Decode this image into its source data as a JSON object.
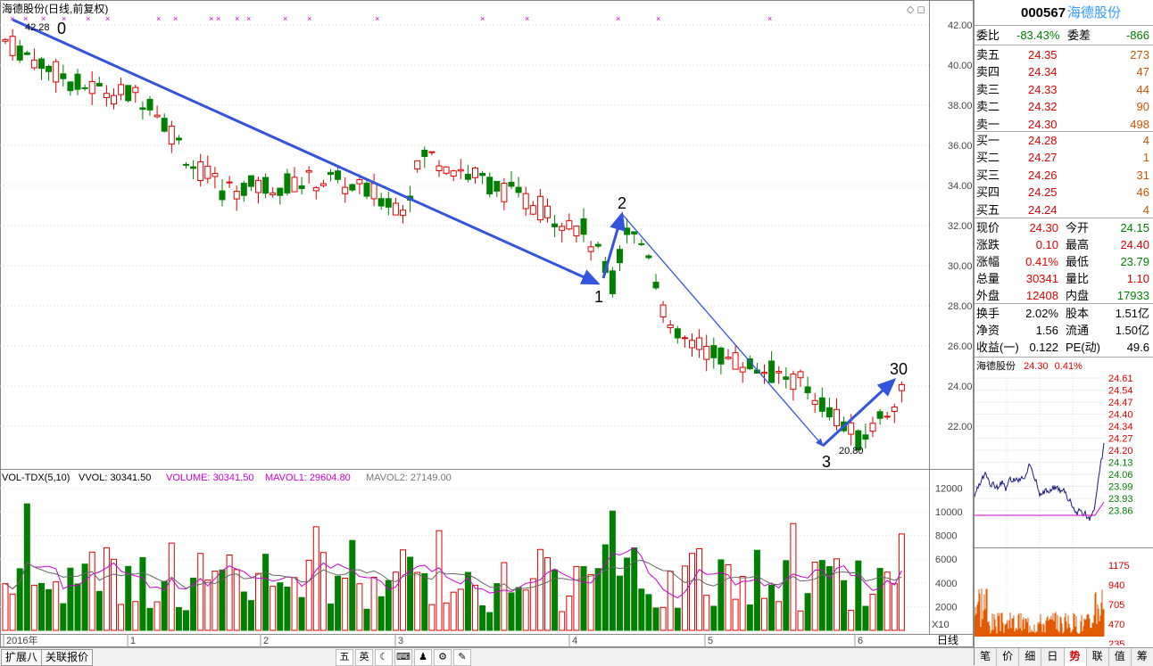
{
  "chart_header": {
    "title": "海德股份(日线,前复权)"
  },
  "price_axis": [
    "42.00",
    "40.00",
    "38.00",
    "36.00",
    "34.00",
    "32.00",
    "30.00",
    "28.00",
    "26.00",
    "24.00",
    "22.00"
  ],
  "annotations": {
    "high_label": "42.28",
    "low_label": "20.80",
    "wave_labels": [
      "0",
      "1",
      "2",
      "3",
      "30"
    ]
  },
  "volume_header": {
    "indicator": "VOL-TDX(5,10)",
    "vvol": "VVOL: 30341.50",
    "volume": "VOLUME: 30341.50",
    "mavol1": "MAVOL1: 29604.80",
    "mavol2": "MAVOL2: 27149.00"
  },
  "volume_axis": [
    "12000",
    "10000",
    "8000",
    "6000",
    "4000",
    "2000"
  ],
  "volume_unit": "X10",
  "date_axis": [
    "2016年",
    "1",
    "2",
    "3",
    "4",
    "5",
    "6"
  ],
  "period_label": "日线",
  "bottom_tabs": [
    "扩展八",
    "关联报价"
  ],
  "toolbar_icons": [
    "五",
    "英",
    "☾",
    "⌨",
    "♟",
    "⚙",
    "✎"
  ],
  "quote": {
    "code": "000567",
    "name": "海德股份",
    "weibi_label": "委比",
    "weibi_value": "-83.43%",
    "weicha_label": "委差",
    "weicha_value": "-866",
    "sells": [
      {
        "label": "卖五",
        "price": "24.35",
        "vol": "273"
      },
      {
        "label": "卖四",
        "price": "24.34",
        "vol": "47"
      },
      {
        "label": "卖三",
        "price": "24.33",
        "vol": "44"
      },
      {
        "label": "卖二",
        "price": "24.32",
        "vol": "90"
      },
      {
        "label": "卖一",
        "price": "24.30",
        "vol": "498"
      }
    ],
    "buys": [
      {
        "label": "买一",
        "price": "24.28",
        "vol": "4"
      },
      {
        "label": "买二",
        "price": "24.27",
        "vol": "1"
      },
      {
        "label": "买三",
        "price": "24.26",
        "vol": "31"
      },
      {
        "label": "买四",
        "price": "24.25",
        "vol": "46"
      },
      {
        "label": "买五",
        "price": "24.24",
        "vol": "4"
      }
    ],
    "stats": [
      {
        "l1": "现价",
        "v1": "24.30",
        "c1": "red",
        "l2": "今开",
        "v2": "24.15",
        "c2": "green"
      },
      {
        "l1": "涨跌",
        "v1": "0.10",
        "c1": "red",
        "l2": "最高",
        "v2": "24.40",
        "c2": "red"
      },
      {
        "l1": "涨幅",
        "v1": "0.41%",
        "c1": "red",
        "l2": "最低",
        "v2": "23.79",
        "c2": "green"
      },
      {
        "l1": "总量",
        "v1": "30341",
        "c1": "red",
        "l2": "量比",
        "v2": "1.10",
        "c2": "red"
      },
      {
        "l1": "外盘",
        "v1": "12408",
        "c1": "red",
        "l2": "内盘",
        "v2": "17933",
        "c2": "green"
      }
    ],
    "stats2": [
      {
        "l1": "换手",
        "v1": "2.02%",
        "l2": "股本",
        "v2": "1.51亿"
      },
      {
        "l1": "净资",
        "v1": "1.56",
        "l2": "流通",
        "v2": "1.50亿"
      },
      {
        "l1": "收益(一)",
        "v1": "0.122",
        "l2": "PE(动)",
        "v2": "49.6"
      }
    ],
    "mini_header": {
      "name": "海德股份",
      "price": "24.30",
      "pct": "0.41%"
    },
    "mini_price_axis": [
      "24.61",
      "24.54",
      "24.47",
      "24.40",
      "24.34",
      "24.27",
      "24.20",
      "24.13",
      "24.06",
      "23.99",
      "23.93",
      "23.86"
    ],
    "mini_vol_axis": [
      "1175",
      "940",
      "705",
      "470",
      "235"
    ],
    "tabs": [
      "笔",
      "价",
      "细",
      "日",
      "势",
      "联",
      "值",
      "筹"
    ],
    "active_tab": "势"
  },
  "colors": {
    "up": "#e00000",
    "down": "#008000",
    "trend": "#3355dd",
    "ma1": "#cc00cc",
    "ma2": "#666666"
  }
}
